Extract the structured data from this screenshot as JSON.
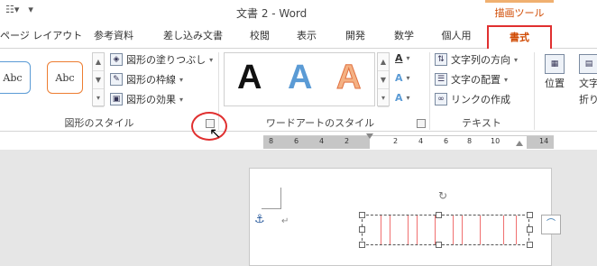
{
  "titlebar": {
    "title": "文書 2 - Word",
    "context_group": "描画ツール",
    "qat_icons": [
      "list-icon",
      "dropdown-icon"
    ]
  },
  "tabs": [
    "ページ レイアウト",
    "参考資料",
    "差し込み文書",
    "校閲",
    "表示",
    "開発",
    "数学",
    "個人用",
    "書式"
  ],
  "active_tab": "書式",
  "shape_styles": {
    "samples": [
      "Abc",
      "Abc"
    ],
    "fill": "図形の塗りつぶし",
    "outline": "図形の枠線",
    "effects": "図形の効果",
    "label": "図形のスタイル"
  },
  "wordart": {
    "letters": [
      "A",
      "A",
      "A"
    ],
    "label": "ワードアートのスタイル",
    "fill_letter": "A",
    "outline_letter": "A",
    "effects_letter": "A"
  },
  "text_group": {
    "direction": "文字列の方向",
    "align": "文字の配置",
    "link": "リンクの作成",
    "label": "テキスト"
  },
  "arrange": {
    "position": "位置",
    "wrap_line1": "文字",
    "wrap_line2": "折り返"
  },
  "ruler": {
    "numbers": [
      "8",
      "6",
      "4",
      "2",
      "2",
      "4",
      "6",
      "8",
      "10",
      "14"
    ]
  },
  "colors": {
    "accent": "#d04a02",
    "highlight": "#e03030",
    "blue": "#5b9bd5",
    "orange": "#f4b183"
  }
}
